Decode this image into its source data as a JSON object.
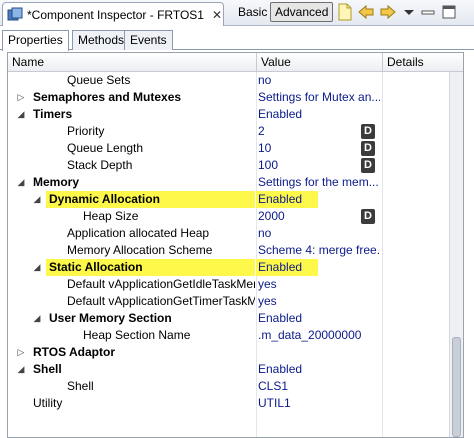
{
  "window": {
    "title": "*Component Inspector - FRTOS1",
    "close_glyph": "✕"
  },
  "toolbar": {
    "basic_label": "Basic",
    "advanced_label": "Advanced"
  },
  "tabs": [
    {
      "label": "Properties",
      "active": true
    },
    {
      "label": "Methods",
      "active": false
    },
    {
      "label": "Events",
      "active": false
    }
  ],
  "table": {
    "headers": {
      "name": "Name",
      "value": "Value",
      "details": "Details"
    },
    "rows": [
      {
        "name": "Queue Sets",
        "value": "no",
        "expander": "",
        "d": false
      },
      {
        "name": "Semaphores and Mutexes",
        "value": "Settings for Mutex an...",
        "expander": "▷",
        "d": false
      },
      {
        "name": "Timers",
        "value": "Enabled",
        "expander": "◢",
        "d": false
      },
      {
        "name": "Priority",
        "value": "2",
        "expander": "",
        "d": true
      },
      {
        "name": "Queue Length",
        "value": "10",
        "expander": "",
        "d": true
      },
      {
        "name": "Stack Depth",
        "value": "100",
        "expander": "",
        "d": true
      },
      {
        "name": "Memory",
        "value": "Settings for the mem...",
        "expander": "◢",
        "d": false
      },
      {
        "name": "Dynamic Allocation",
        "value": "Enabled",
        "expander": "◢",
        "d": false
      },
      {
        "name": "Heap Size",
        "value": "2000",
        "expander": "",
        "d": true
      },
      {
        "name": "Application allocated Heap",
        "value": "no",
        "expander": "",
        "d": false
      },
      {
        "name": "Memory Allocation Scheme",
        "value": "Scheme 4: merge free...",
        "expander": "",
        "d": false
      },
      {
        "name": "Static Allocation",
        "value": "Enabled",
        "expander": "◢",
        "d": false
      },
      {
        "name": "Default vApplicationGetIdleTaskMem",
        "value": "yes",
        "expander": "",
        "d": false
      },
      {
        "name": "Default vApplicationGetTimerTaskMe",
        "value": "yes",
        "expander": "",
        "d": false
      },
      {
        "name": "User Memory Section",
        "value": "Enabled",
        "expander": "◢",
        "d": false
      },
      {
        "name": "Heap Section Name",
        "value": ".m_data_20000000",
        "expander": "",
        "d": false
      },
      {
        "name": "RTOS Adaptor",
        "value": "",
        "expander": "▷",
        "d": false
      },
      {
        "name": "Shell",
        "value": "Enabled",
        "expander": "◢",
        "d": false
      },
      {
        "name": "Shell",
        "value": "CLS1",
        "expander": "",
        "d": false
      },
      {
        "name": "Utility",
        "value": "UTIL1",
        "expander": "",
        "d": false
      }
    ],
    "d_label": "D"
  },
  "colors": {
    "value_text": "#0a1a8a",
    "highlight": "#fdf84a",
    "d_button": "#3b3b3b"
  }
}
